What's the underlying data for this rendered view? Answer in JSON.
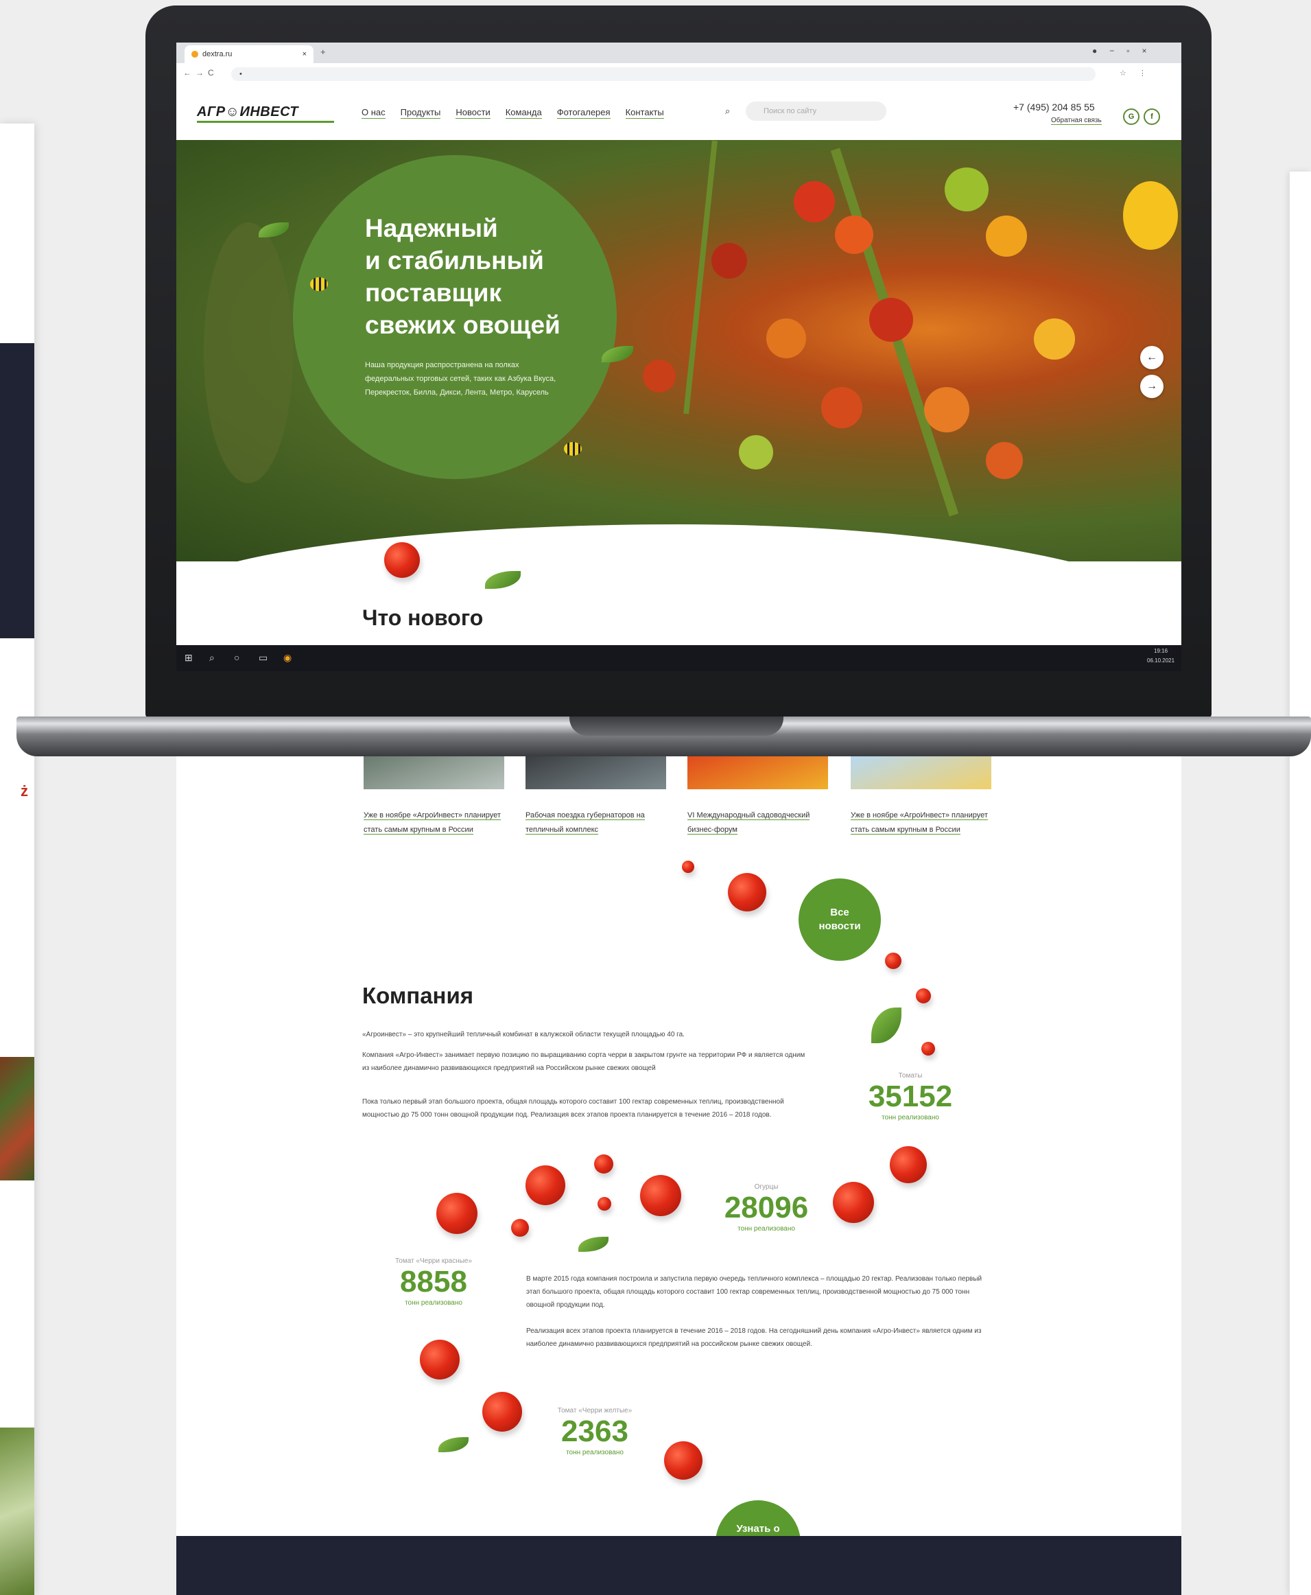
{
  "browser": {
    "tab_title": "dextra.ru",
    "url": "•"
  },
  "header": {
    "logo": "АГР☺ИНВЕСТ",
    "nav": [
      "О нас",
      "Продукты",
      "Новости",
      "Команда",
      "Фотогалерея",
      "Контакты"
    ],
    "search_placeholder": "Поиск по сайту",
    "phone": "+7 (495) 204 85 55",
    "callback": "Обратная связь",
    "social": [
      "G",
      "f"
    ]
  },
  "hero": {
    "title_lines": [
      "Надежный",
      "и стабильный",
      "поставщик",
      "свежих овощей"
    ],
    "text": "Наша продукция распространена на полках федеральных торговых сетей, таких как Азбука Вкуса, Перекресток, Билла, Дикси, Лента, Метро, Карусель",
    "prev": "←",
    "next": "→"
  },
  "news": {
    "title": "Что нового",
    "items": [
      "Уже в ноябре «АгроИнвест» планирует стать самым крупным в России",
      "Рабочая поездка губернаторов на тепличный комплекс",
      "VI Международный садоводческий бизнес-форум",
      "Уже в ноябре «АгроИнвест» планирует стать самым крупным в России"
    ],
    "all_button": "Все новости"
  },
  "company": {
    "title": "Компания",
    "paragraphs": [
      "«Агроинвест» – это крупнейший тепличный комбинат в калужской области текущей площадью 40 га.",
      "Компания «Агро-Инвест» занимает первую позицию по выращиванию сорта черри в закрытом грунте на территории РФ и является одним из наиболее динамично развивающихся предприятий на Российском рынке свежих овощей",
      "Пока только первый этап большого проекта, общая площадь которого составит 100 гектар современных теплиц, производственной мощностью до 75 000 тонн овощной продукции под. Реализация всех этапов проекта планируется в течение 2016 – 2018 годов."
    ],
    "paragraphs2": [
      "В марте 2015 года компания построила и запустила первую очередь тепличного комплекса – площадью 20 гектар. Реализован только первый этап большого проекта, общая площадь которого составит 100 гектар современных теплиц, производственной мощностью до 75 000 тонн овощной продукции под.",
      "Реализация всех этапов проекта планируется в течение 2016 – 2018 годов. На сегодняшний день компания «Агро-Инвест» является одним из наиболее динамично развивающихся предприятий на российском рынке свежих овощей."
    ],
    "stats": [
      {
        "label": "Томаты",
        "value": "35152",
        "sub": "тонн реализовано"
      },
      {
        "label": "Огурцы",
        "value": "28096",
        "sub": "тонн реализовано"
      },
      {
        "label": "Томат «Черри красные»",
        "value": "8858",
        "sub": "тонн реализовано"
      },
      {
        "label": "Томат «Черри желтые»",
        "value": "2363",
        "sub": "тонн реализовано"
      }
    ],
    "more_button": "Узнать о нас больше"
  },
  "taskbar": {
    "time": "19:16",
    "date": "06.10.2021"
  }
}
